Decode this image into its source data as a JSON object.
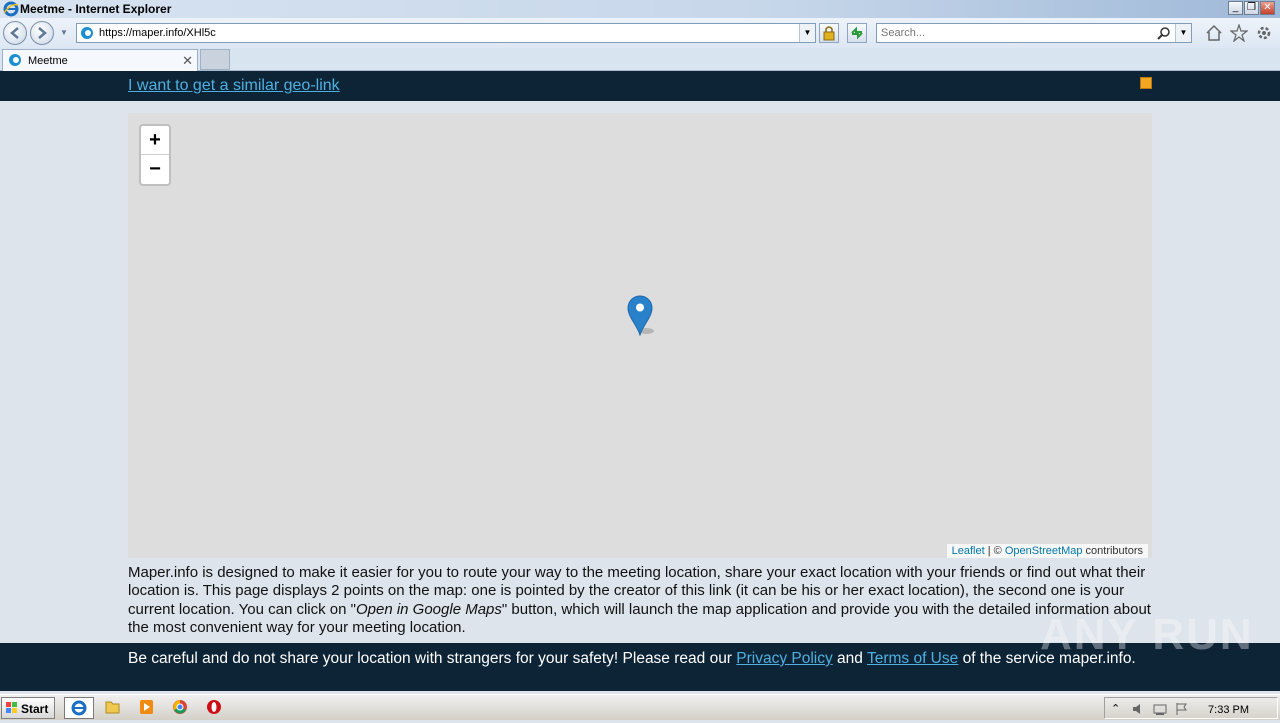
{
  "window": {
    "title": "Meetme - Internet Explorer",
    "minimize": "_",
    "maximize": "❐",
    "close": "✕"
  },
  "navbar": {
    "url": "https://maper.info/XHl5c",
    "search_placeholder": "Search..."
  },
  "tabs": [
    {
      "label": "Meetme",
      "active": true
    }
  ],
  "header": {
    "link_text": "I want to get a similar geo-link"
  },
  "map": {
    "zoom_in": "+",
    "zoom_out": "−",
    "attribution": {
      "leaflet": "Leaflet",
      "separator": " | © ",
      "osm": "OpenStreetMap",
      "suffix": " contributors"
    }
  },
  "description": {
    "part1": "Maper.info is designed to make it easier for you to route your way to the meeting location, share your exact location with your friends or find out what their location is. This page displays 2 points on the map: one is pointed by the creator of this link (it can be his or her exact location), the second one is your current location. You can click on \"",
    "italic": "Open in Google Maps",
    "part2": "\" button, which will launch the map application and provide you with the detailed information about the most convenient way for your meeting location."
  },
  "footer": {
    "text1": "Be careful and do not share your location with strangers for your safety! Please read our ",
    "privacy": "Privacy Policy",
    "and": " and ",
    "terms": "Terms of Use",
    "text2": " of the service maper.info."
  },
  "watermark": "ANY RUN",
  "taskbar": {
    "start_label": "Start",
    "clock": "7:33 PM"
  },
  "colors": {
    "header_bg": "#0d2437",
    "link": "#4fb0e0",
    "marker": "#2a81cb"
  }
}
